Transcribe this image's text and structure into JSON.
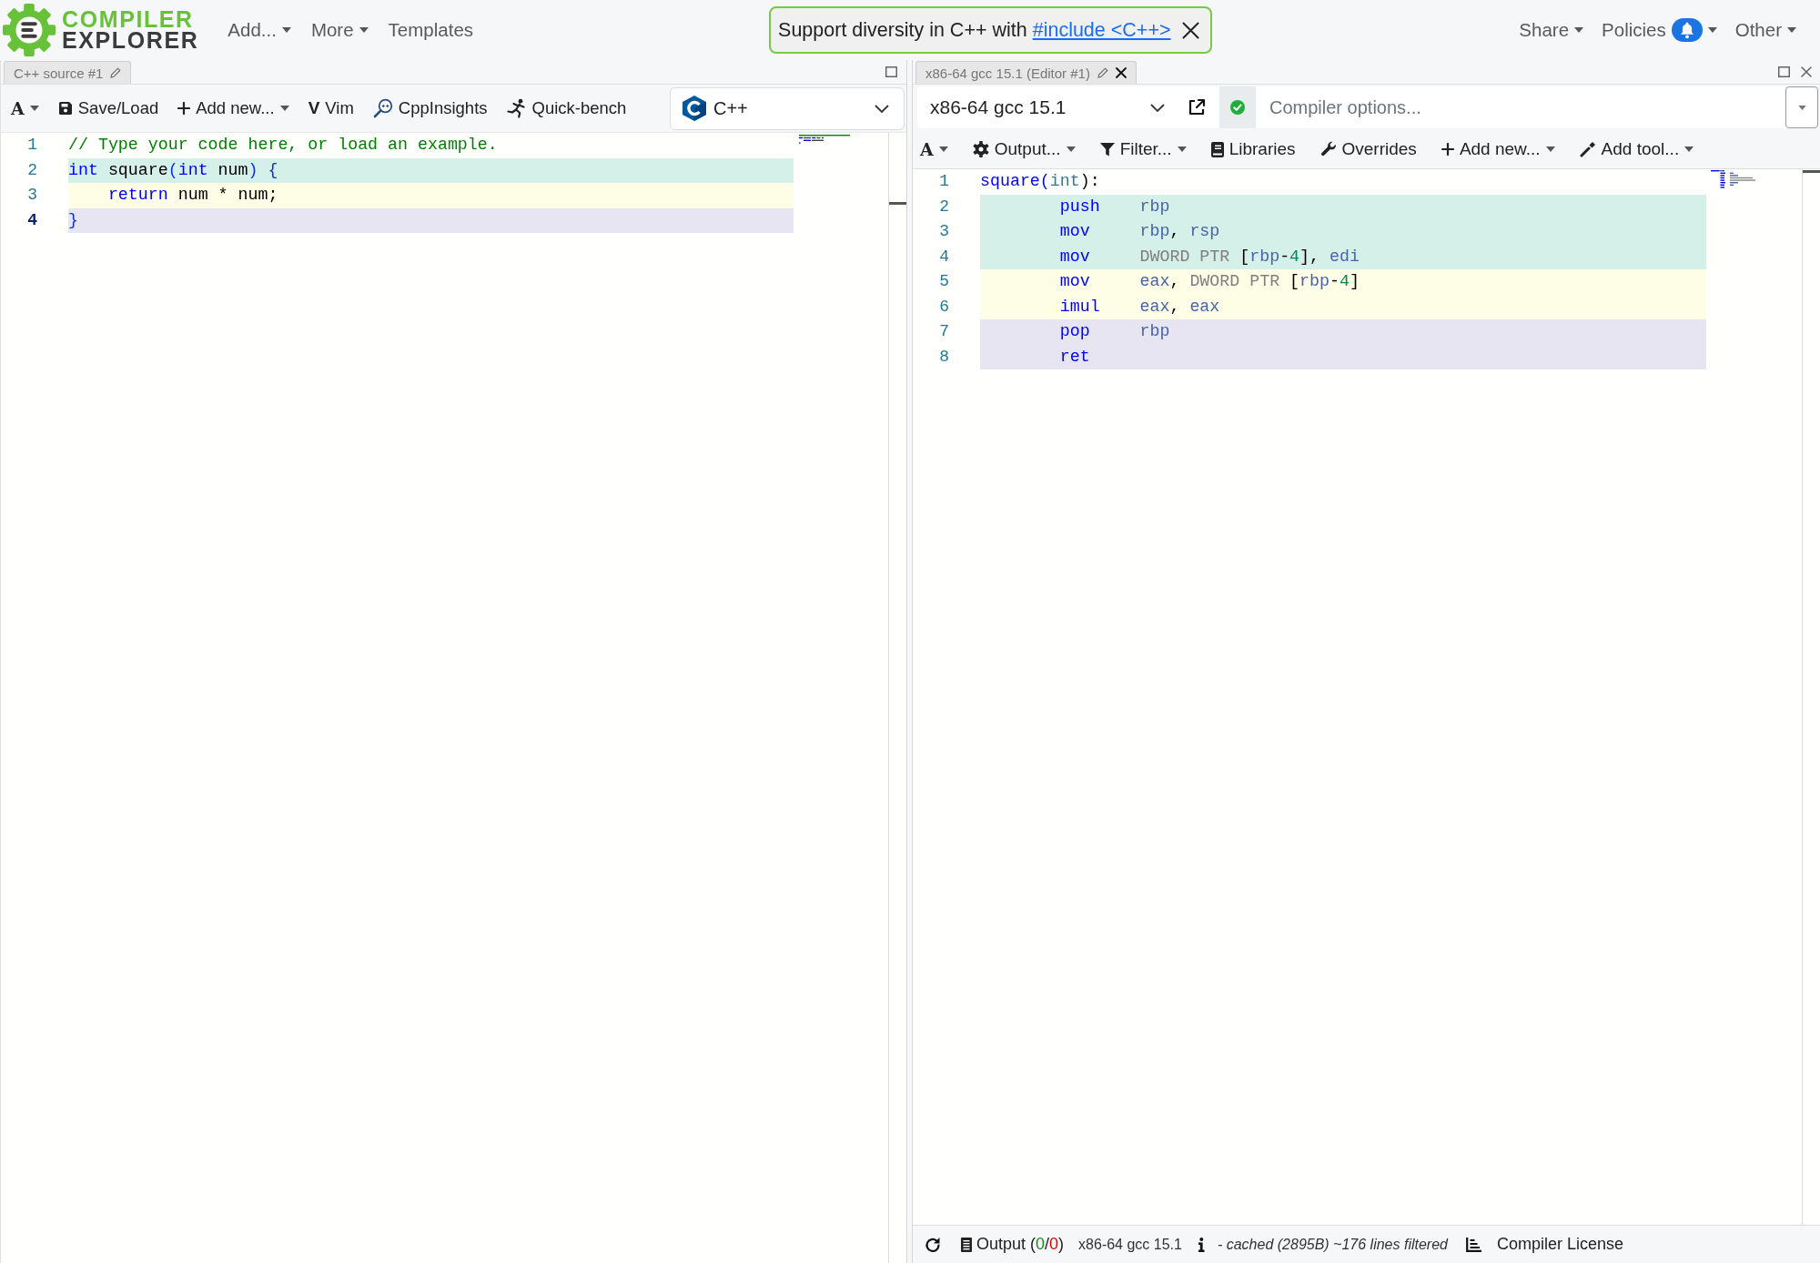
{
  "header": {
    "logo": {
      "line_1": "COMPILER",
      "line_2": "EXPLORER"
    },
    "menu": [
      {
        "label": "Add...",
        "dropdown": true
      },
      {
        "label": "More",
        "dropdown": true
      },
      {
        "label": "Templates",
        "dropdown": false
      }
    ],
    "banner": {
      "text": "Support diversity in C++ with ",
      "link": "#include <C++>"
    },
    "right_menu": [
      {
        "label": "Share",
        "dropdown": true,
        "notification": false
      },
      {
        "label": "Policies",
        "dropdown": true,
        "notification": true
      },
      {
        "label": "Other",
        "dropdown": true,
        "notification": false
      }
    ]
  },
  "source_pane": {
    "tab": {
      "title": "C++ source #1"
    },
    "toolbar": [
      {
        "kind": "font",
        "glyph": "A",
        "dropdown": true
      },
      {
        "kind": "save",
        "label": "Save/Load",
        "dropdown": false
      },
      {
        "kind": "add",
        "label": "Add new...",
        "dropdown": true
      },
      {
        "kind": "vim",
        "glyph": "V",
        "label": "Vim",
        "dropdown": false
      },
      {
        "kind": "insights",
        "label": "CppInsights",
        "dropdown": false
      },
      {
        "kind": "bench",
        "label": "Quick-bench",
        "dropdown": false
      }
    ],
    "language": {
      "value": "C++"
    },
    "lines": [
      {
        "number": "1",
        "current": false,
        "tokens": [
          {
            "kind": "comment",
            "text": "// Type your code here, or load an example."
          }
        ]
      },
      {
        "number": "2",
        "current": false,
        "color": "#d5efe9",
        "tokens": [
          {
            "kind": "keyword",
            "text": "int"
          },
          {
            "kind": "plain",
            "text": " square"
          },
          {
            "kind": "bracket",
            "text": "("
          },
          {
            "kind": "keyword",
            "text": "int"
          },
          {
            "kind": "plain",
            "text": " num"
          },
          {
            "kind": "bracket",
            "text": ")"
          },
          {
            "kind": "bracket",
            "text": " {"
          }
        ]
      },
      {
        "number": "3",
        "current": false,
        "color": "#fefde6",
        "tokens": [
          {
            "kind": "keyword",
            "text": "    return"
          },
          {
            "kind": "plain",
            "text": " num * num;"
          }
        ]
      },
      {
        "number": "4",
        "current": true,
        "color": "#e6e5f1",
        "tokens": [
          {
            "kind": "bracket",
            "text": "}"
          }
        ]
      }
    ]
  },
  "compiler_pane": {
    "tab": {
      "title": "x86-64 gcc 15.1 (Editor #1)"
    },
    "compiler": {
      "value": "x86-64 gcc 15.1"
    },
    "compiled": true,
    "options": {
      "placeholder": "Compiler options..."
    },
    "toolbar": [
      {
        "kind": "font",
        "glyph": "A",
        "dropdown": true
      },
      {
        "kind": "output",
        "label": "Output...",
        "dropdown": true
      },
      {
        "kind": "filter",
        "label": "Filter...",
        "dropdown": true
      },
      {
        "kind": "libraries",
        "label": "Libraries",
        "dropdown": false
      },
      {
        "kind": "overrides",
        "label": "Overrides",
        "dropdown": false
      },
      {
        "kind": "add",
        "label": "Add new...",
        "dropdown": true
      },
      {
        "kind": "tool",
        "label": "Add tool...",
        "dropdown": true
      }
    ],
    "lines": [
      {
        "number": "1",
        "kind": "label",
        "tokens": [
          {
            "kind": "label",
            "text": "square("
          },
          {
            "kind": "type",
            "text": "int"
          },
          {
            "kind": "plain",
            "text": "):"
          }
        ]
      },
      {
        "number": "2",
        "kind": "instruction",
        "color": "#d5efe9",
        "mnemonic": "push",
        "operands": [
          {
            "kind": "register",
            "text": "rbp"
          }
        ]
      },
      {
        "number": "3",
        "kind": "instruction",
        "color": "#d5efe9",
        "mnemonic": "mov",
        "operands": [
          {
            "kind": "register",
            "text": "rbp"
          },
          {
            "kind": "plain",
            "text": ", "
          },
          {
            "kind": "register",
            "text": "rsp"
          }
        ]
      },
      {
        "number": "4",
        "kind": "instruction",
        "color": "#d5efe9",
        "mnemonic": "mov",
        "operands": [
          {
            "kind": "size",
            "text": "DWORD PTR "
          },
          {
            "kind": "plain",
            "text": "["
          },
          {
            "kind": "register",
            "text": "rbp"
          },
          {
            "kind": "plain",
            "text": "-"
          },
          {
            "kind": "number",
            "text": "4"
          },
          {
            "kind": "plain",
            "text": "], "
          },
          {
            "kind": "register",
            "text": "edi"
          }
        ]
      },
      {
        "number": "5",
        "kind": "instruction",
        "color": "#fefde6",
        "mnemonic": "mov",
        "operands": [
          {
            "kind": "register",
            "text": "eax"
          },
          {
            "kind": "plain",
            "text": ", "
          },
          {
            "kind": "size",
            "text": "DWORD PTR "
          },
          {
            "kind": "plain",
            "text": "["
          },
          {
            "kind": "register",
            "text": "rbp"
          },
          {
            "kind": "plain",
            "text": "-"
          },
          {
            "kind": "number",
            "text": "4"
          },
          {
            "kind": "plain",
            "text": "]"
          }
        ]
      },
      {
        "number": "6",
        "kind": "instruction",
        "color": "#fefde6",
        "mnemonic": "imul",
        "operands": [
          {
            "kind": "register",
            "text": "eax"
          },
          {
            "kind": "plain",
            "text": ", "
          },
          {
            "kind": "register",
            "text": "eax"
          }
        ]
      },
      {
        "number": "7",
        "kind": "instruction",
        "color": "#e6e5f1",
        "mnemonic": "pop",
        "operands": [
          {
            "kind": "register",
            "text": "rbp"
          }
        ]
      },
      {
        "number": "8",
        "kind": "instruction",
        "color": "#e6e5f1",
        "mnemonic": "ret"
      }
    ],
    "status_bar": {
      "output": [
        {
          "kind": "text",
          "text": "Output ("
        },
        {
          "kind": "ok",
          "text": "0"
        },
        {
          "kind": "text",
          "text": "/"
        },
        {
          "kind": "error",
          "text": "0"
        },
        {
          "kind": "text",
          "text": ")"
        }
      ],
      "compiler": "x86-64 gcc 15.1",
      "cache_info": "- cached (2895B) ~176 lines filtered",
      "license": "Compiler License"
    }
  }
}
